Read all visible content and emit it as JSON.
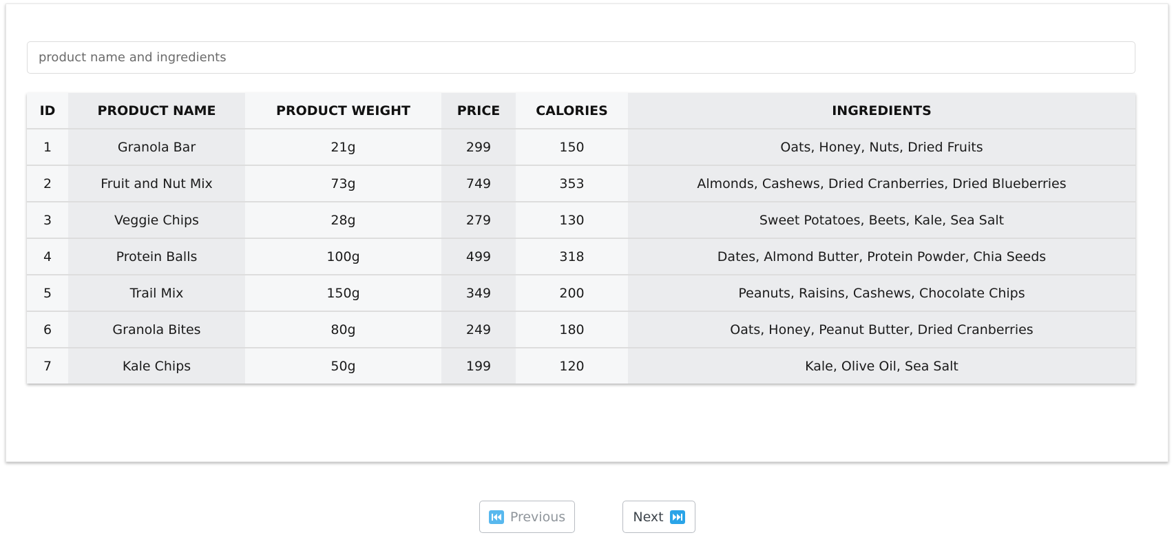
{
  "search": {
    "placeholder": "product name and ingredients",
    "value": ""
  },
  "table": {
    "columns": [
      "ID",
      "PRODUCT NAME",
      "PRODUCT WEIGHT",
      "PRICE",
      "CALORIES",
      "INGREDIENTS"
    ],
    "rows": [
      [
        "1",
        "Granola Bar",
        "21g",
        "299",
        "150",
        "Oats, Honey, Nuts, Dried Fruits"
      ],
      [
        "2",
        "Fruit and Nut Mix",
        "73g",
        "749",
        "353",
        "Almonds, Cashews, Dried Cranberries, Dried Blueberries"
      ],
      [
        "3",
        "Veggie Chips",
        "28g",
        "279",
        "130",
        "Sweet Potatoes, Beets, Kale, Sea Salt"
      ],
      [
        "4",
        "Protein Balls",
        "100g",
        "499",
        "318",
        "Dates, Almond Butter, Protein Powder, Chia Seeds"
      ],
      [
        "5",
        "Trail Mix",
        "150g",
        "349",
        "200",
        "Peanuts, Raisins, Cashews, Chocolate Chips"
      ],
      [
        "6",
        "Granola Bites",
        "80g",
        "249",
        "180",
        "Oats, Honey, Peanut Butter, Dried Cranberries"
      ],
      [
        "7",
        "Kale Chips",
        "50g",
        "199",
        "120",
        "Kale, Olive Oil, Sea Salt"
      ]
    ]
  },
  "pagination": {
    "previous_label": "Previous",
    "previous_icon": "rewind-icon",
    "next_label": "Next",
    "next_icon": "fast-forward-icon"
  },
  "colors": {
    "column_light": "#f6f7f8",
    "column_dark": "#ebecee",
    "icon_accent": "#2aa4e8"
  }
}
